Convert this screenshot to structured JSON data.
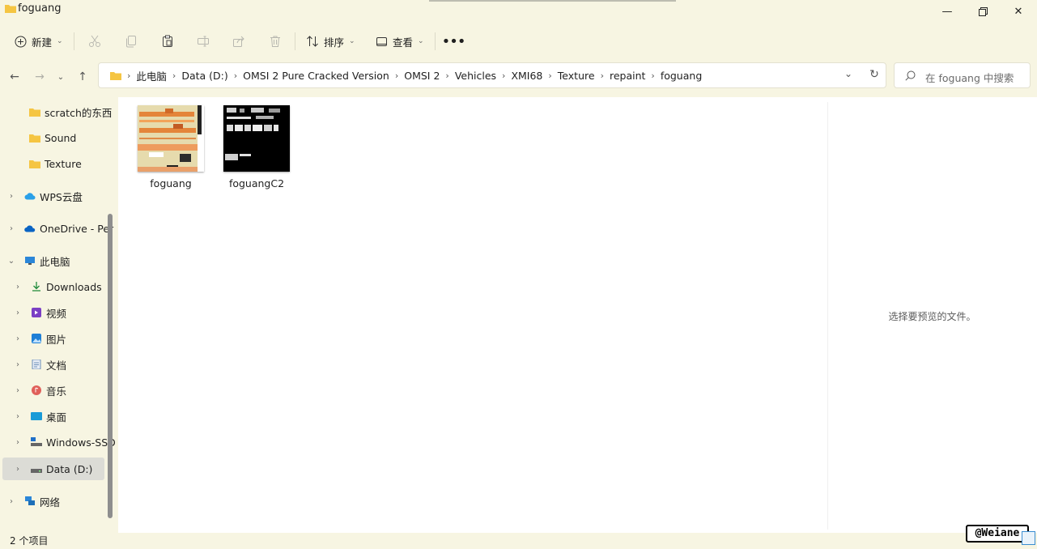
{
  "window": {
    "title": "foguang",
    "controls": [
      "minimize",
      "restore",
      "close"
    ]
  },
  "toolbar": {
    "new_label": "新建",
    "sort_label": "排序",
    "view_label": "查看",
    "icons": [
      "cut-icon",
      "copy-icon",
      "paste-icon",
      "rename-icon",
      "share-icon",
      "delete-icon"
    ]
  },
  "address": {
    "crumbs": [
      "此电脑",
      "Data (D:)",
      "OMSI 2 Pure Cracked Version",
      "OMSI 2",
      "Vehicles",
      "XMI68",
      "Texture",
      "repaint",
      "foguang"
    ]
  },
  "search": {
    "placeholder": "在 foguang 中搜索"
  },
  "nav": {
    "items": [
      {
        "label": "scratch的东西",
        "icon": "folder-icon"
      },
      {
        "label": "Sound",
        "icon": "folder-icon"
      },
      {
        "label": "Texture",
        "icon": "folder-icon"
      },
      {
        "label": "WPS云盘",
        "icon": "cloud-icon"
      },
      {
        "label": "OneDrive - Per",
        "icon": "onedrive-icon"
      },
      {
        "label": "此电脑",
        "icon": "pc-icon"
      },
      {
        "label": "Downloads",
        "icon": "download-icon"
      },
      {
        "label": "视频",
        "icon": "video-icon"
      },
      {
        "label": "图片",
        "icon": "pictures-icon"
      },
      {
        "label": "文档",
        "icon": "documents-icon"
      },
      {
        "label": "音乐",
        "icon": "music-icon"
      },
      {
        "label": "桌面",
        "icon": "desktop-icon"
      },
      {
        "label": "Windows-SSD",
        "icon": "drive-icon"
      },
      {
        "label": "Data (D:)",
        "icon": "drive-icon"
      },
      {
        "label": "网络",
        "icon": "network-icon"
      }
    ]
  },
  "files": [
    {
      "name": "foguang"
    },
    {
      "name": "foguangC2"
    }
  ],
  "preview": {
    "empty_text": "选择要预览的文件。"
  },
  "status": {
    "item_count": "2 个项目"
  },
  "watermark": {
    "text": "@Weiane"
  },
  "colors": {
    "background": "#f7f5e2",
    "content": "#ffffff",
    "accent": "#0067c0",
    "folder": "#f5c542"
  }
}
